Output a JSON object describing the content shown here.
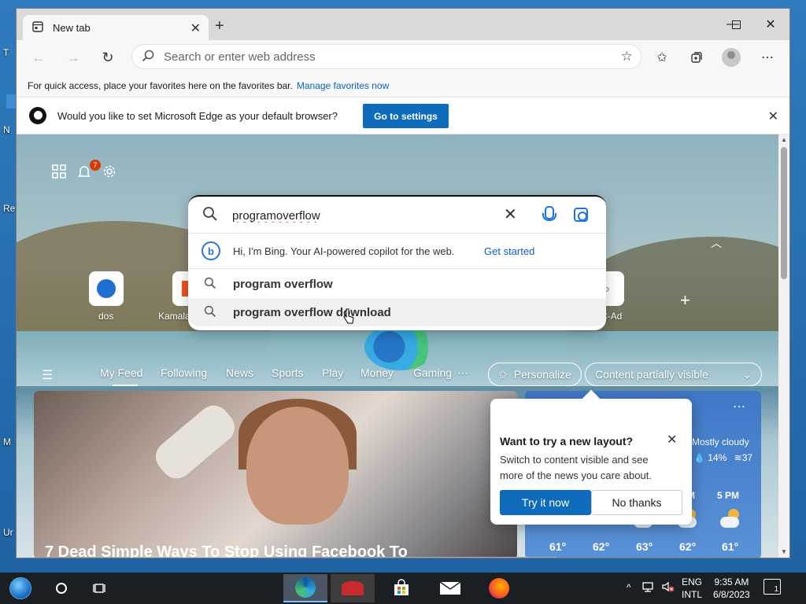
{
  "desktop": {
    "labels": [
      "T",
      "N",
      "Re",
      "M",
      "Ur"
    ]
  },
  "browser": {
    "tab_title": "New tab",
    "address_placeholder": "Search or enter web address",
    "favorites_bar": {
      "text": "For quick access, place your favorites here on the favorites bar.",
      "link": "Manage favorites now"
    },
    "infobar": {
      "message": "Would you like to set Microsoft Edge as your default browser?",
      "button": "Go to settings"
    }
  },
  "ntp": {
    "notification_count": "7",
    "search": {
      "value": "programoverflow",
      "bing_prompt": "Hi, I'm Bing. Your AI-powered copilot for the web.",
      "bing_link": "Get started",
      "suggestions": [
        "program overflow",
        "program overflow download"
      ]
    },
    "quick_links": [
      "dos",
      "Kamala",
      "C-Ad"
    ],
    "feed_tabs": [
      "My Feed",
      "Following",
      "News",
      "Sports",
      "Play",
      "Money",
      "Gaming",
      "⋯"
    ],
    "personalize": "Personalize",
    "content_mode": "Content partially visible",
    "news_headline": "7 Dead Simple Ways To Stop Using Facebook To",
    "weather": {
      "more": "⋯",
      "condition": "Mostly cloudy",
      "precip": "14%",
      "wind": "37",
      "hours": [
        "M",
        "5 PM"
      ],
      "temps": [
        "61°",
        "62°",
        "63°",
        "62°",
        "61°"
      ]
    },
    "layout_popup": {
      "title": "Want to try a new layout?",
      "body": "Switch to content visible and see more of the news you care about.",
      "primary": "Try it now",
      "secondary": "No thanks"
    }
  },
  "taskbar": {
    "lang_1": "ENG",
    "lang_2": "INTL",
    "time": "9:35 AM",
    "date": "6/8/2023",
    "notifications": "1"
  },
  "colors": {
    "accent": "#0f6cbd",
    "link": "#0b62c4",
    "badge": "#d83b01"
  }
}
